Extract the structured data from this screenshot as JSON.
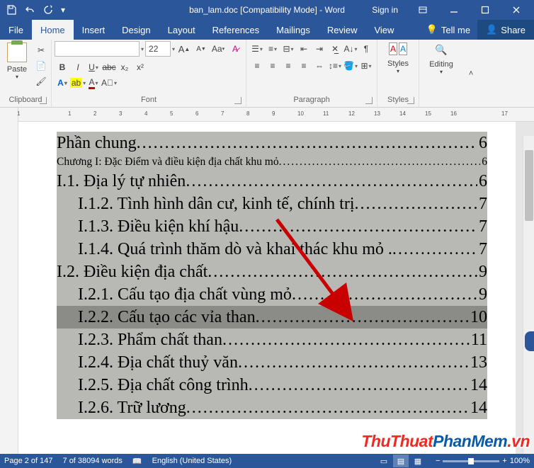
{
  "title": "ban_lam.doc [Compatibility Mode] - Word",
  "signin": "Sign in",
  "tabs": {
    "file": "File",
    "home": "Home",
    "insert": "Insert",
    "design": "Design",
    "layout": "Layout",
    "references": "References",
    "mailings": "Mailings",
    "review": "Review",
    "view": "View",
    "tell": "Tell me",
    "share": "Share"
  },
  "ribbon": {
    "clipboard": {
      "label": "Clipboard",
      "paste": "Paste"
    },
    "font": {
      "label": "Font",
      "name": "",
      "size": "22"
    },
    "paragraph": {
      "label": "Paragraph"
    },
    "styles": {
      "label": "Styles",
      "btn": "Styles"
    },
    "editing": {
      "label": "",
      "btn": "Editing"
    }
  },
  "ruler_ticks": [
    "1",
    "",
    "1",
    "2",
    "3",
    "4",
    "5",
    "6",
    "7",
    "8",
    "9",
    "10",
    "11",
    "12",
    "13",
    "14",
    "15",
    "16",
    "",
    "17"
  ],
  "toc": [
    {
      "lvl": 0,
      "text": "Phần chung ",
      "page": "6",
      "class": "toc-l0"
    },
    {
      "lvl": 1,
      "text": "Chương I: Đặc Điểm và điều kiện địa chất khu mỏ ",
      "page": "6",
      "class": "toc-l1"
    },
    {
      "lvl": 0,
      "text": "I.1. Địa lý tự  nhiên",
      "page": "6",
      "class": "toc-l0b"
    },
    {
      "lvl": 2,
      "text": "I.1.2.  Tình hình dân cư, kinh tế, chính trị ",
      "page": "7",
      "class": "toc-l2"
    },
    {
      "lvl": 2,
      "text": "I.1.3. Điều kiện khí hậu ",
      "page": "7",
      "class": "toc-l2"
    },
    {
      "lvl": 2,
      "text": "I.1.4. Quá trình thăm dò và khai thác khu mỏ .",
      "page": "7",
      "class": "toc-l2"
    },
    {
      "lvl": 0,
      "text": "I.2. Điều kiện địa chất",
      "page": "9",
      "class": "toc-l0b"
    },
    {
      "lvl": 2,
      "text": "I.2.1. Cấu tạo địa chất vùng mỏ ",
      "page": "9",
      "class": "toc-l2"
    },
    {
      "lvl": 2,
      "text": "I.2.2. Cấu tạo các vỉa than ",
      "page": "10",
      "class": "toc-l2",
      "hl": true
    },
    {
      "lvl": 2,
      "text": "I.2.3. Phẩm chất than ",
      "page": "11",
      "class": "toc-l2"
    },
    {
      "lvl": 2,
      "text": "I.2.4. Địa chất thuỷ văn",
      "page": "13",
      "class": "toc-l2"
    },
    {
      "lvl": 2,
      "text": "I.2.5. Địa chất công trình ",
      "page": "14",
      "class": "toc-l2"
    },
    {
      "lvl": 2,
      "text": "I.2.6. Trữ lương",
      "page": "14",
      "class": "toc-l2"
    }
  ],
  "status": {
    "page": "Page 2 of 147",
    "words": "7 of 38094 words",
    "lang": "English (United States)",
    "zoom": "100%"
  },
  "watermark": {
    "a": "ThuThuat",
    "b": "PhanMem",
    "c": ".vn"
  }
}
